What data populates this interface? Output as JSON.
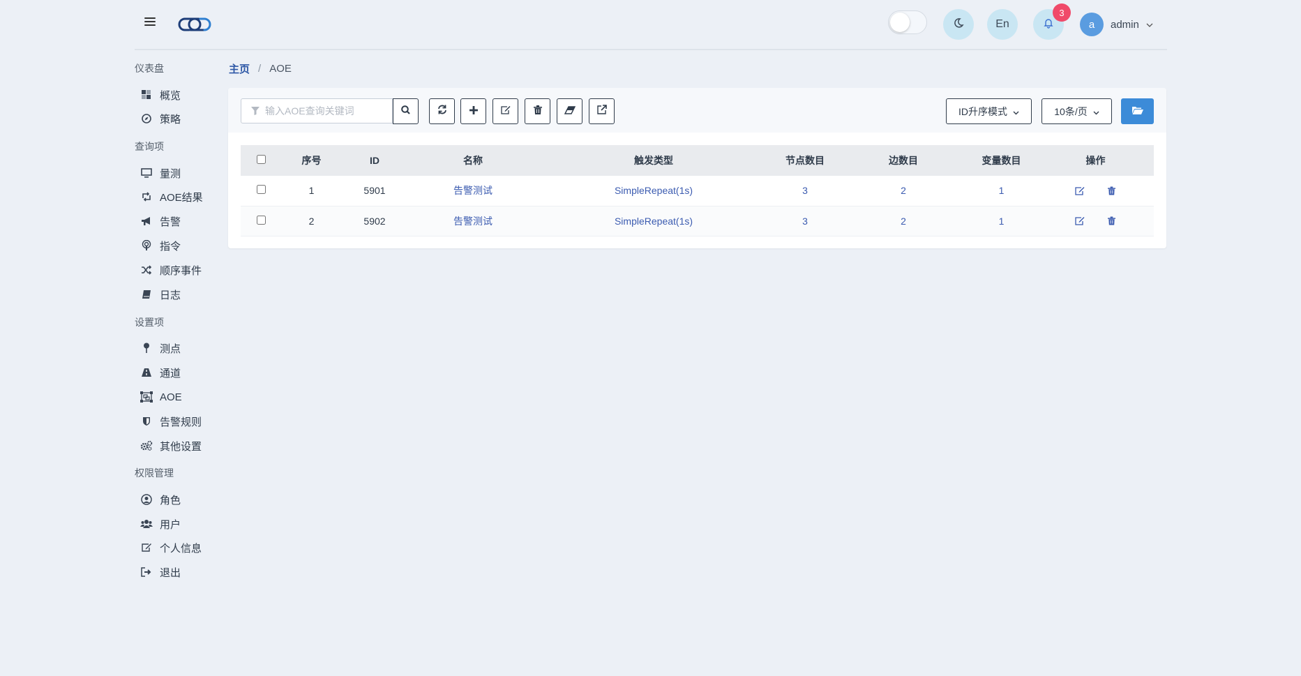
{
  "header": {
    "lang_label": "En",
    "notification_count": "3",
    "user": {
      "avatar_letter": "a",
      "name": "admin"
    }
  },
  "sidebar": {
    "sections": [
      {
        "title": "仪表盘",
        "items": [
          {
            "label": "概览",
            "icon": "overview-icon"
          },
          {
            "label": "策略",
            "icon": "compass-icon"
          }
        ]
      },
      {
        "title": "查询项",
        "items": [
          {
            "label": "量测",
            "icon": "monitor-icon"
          },
          {
            "label": "AOE结果",
            "icon": "retweet-icon"
          },
          {
            "label": "告警",
            "icon": "bullhorn-icon"
          },
          {
            "label": "指令",
            "icon": "podcast-icon"
          },
          {
            "label": "顺序事件",
            "icon": "random-icon"
          },
          {
            "label": "日志",
            "icon": "book-icon"
          }
        ]
      },
      {
        "title": "设置项",
        "items": [
          {
            "label": "测点",
            "icon": "map-pin-icon"
          },
          {
            "label": "通道",
            "icon": "road-icon"
          },
          {
            "label": "AOE",
            "icon": "object-group-icon"
          },
          {
            "label": "告警规则",
            "icon": "shield-icon"
          },
          {
            "label": "其他设置",
            "icon": "cogs-icon"
          }
        ]
      },
      {
        "title": "权限管理",
        "items": [
          {
            "label": "角色",
            "icon": "user-circle-icon"
          },
          {
            "label": "用户",
            "icon": "users-icon"
          },
          {
            "label": "个人信息",
            "icon": "edit-icon"
          },
          {
            "label": "退出",
            "icon": "sign-out-icon"
          }
        ]
      }
    ]
  },
  "breadcrumb": {
    "home": "主页",
    "separator": "/",
    "current": "AOE"
  },
  "toolbar": {
    "search_placeholder": "输入AOE查询关键词",
    "sort_mode": "ID升序模式",
    "page_size": "10条/页"
  },
  "table": {
    "headers": [
      "序号",
      "ID",
      "名称",
      "触发类型",
      "节点数目",
      "边数目",
      "变量数目",
      "操作"
    ],
    "rows": [
      {
        "index": "1",
        "id": "5901",
        "name": "告警测试",
        "trigger": "SimpleRepeat(1s)",
        "nodes": "3",
        "edges": "2",
        "vars": "1"
      },
      {
        "index": "2",
        "id": "5902",
        "name": "告警测试",
        "trigger": "SimpleRepeat(1s)",
        "nodes": "3",
        "edges": "2",
        "vars": "1"
      }
    ]
  },
  "colors": {
    "accent": "#3c8bd8",
    "link": "#3b5bb0",
    "badge": "#f04a6a",
    "background": "#ecf0f6"
  }
}
